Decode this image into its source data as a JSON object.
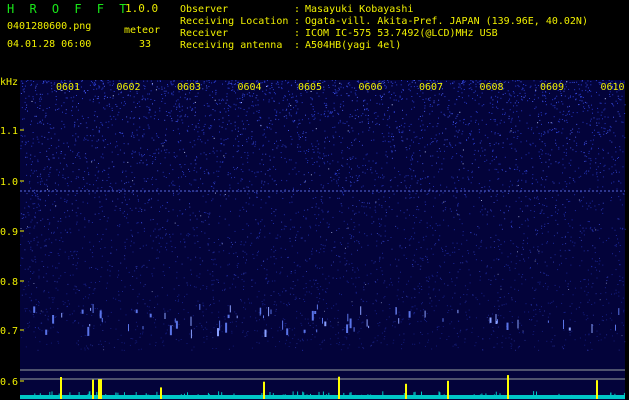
{
  "header": {
    "app_name": "H R O F F T",
    "version": "1.0.0",
    "filename": "0401280600.png",
    "datetime": "04.01.28 06:00",
    "meteor_label": "meteor",
    "meteor_count": "33"
  },
  "info": [
    {
      "label": "Observer",
      "value": "Masayuki Kobayashi"
    },
    {
      "label": "Receiving Location",
      "value": "Ogata-vill. Akita-Pref. JAPAN (139.96E, 40.02N)"
    },
    {
      "label": "Receiver",
      "value": "ICOM IC-575 53.7492(@LCD)MHz USB"
    },
    {
      "label": "Receiving antenna",
      "value": "A504HB(yagi 4el)"
    }
  ],
  "spectrogram": {
    "unit_label": "kHz",
    "y_ticks": [
      "1.1",
      "1.0",
      "0.9",
      "0.8",
      "0.7",
      "0.6"
    ],
    "time_labels": [
      "0601",
      "0602",
      "0603",
      "0604",
      "0605",
      "0606",
      "0607",
      "0608",
      "0609",
      "0610"
    ],
    "colors": {
      "background": "#03033a",
      "noise": "#2a3dd0",
      "label": "#f0f000",
      "count_bars": "#ffff00",
      "count_base": "#00c8c8"
    }
  }
}
